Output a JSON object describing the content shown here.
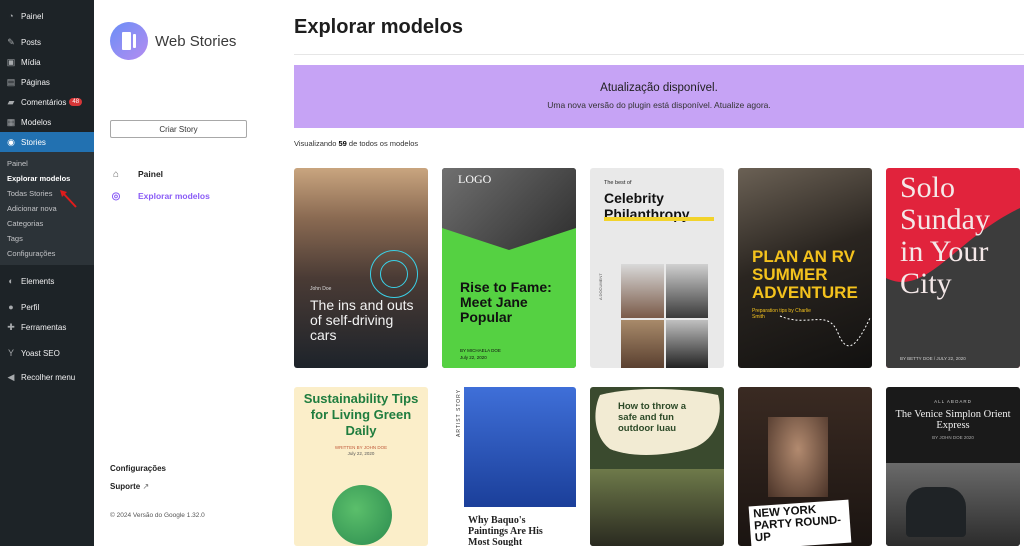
{
  "wp_menu": {
    "items": [
      {
        "label": "Painel",
        "icon": "dashboard-icon"
      },
      {
        "label": "Posts",
        "icon": "pin-icon"
      },
      {
        "label": "Mídia",
        "icon": "media-icon"
      },
      {
        "label": "Páginas",
        "icon": "pages-icon"
      },
      {
        "label": "Comentários",
        "icon": "comments-icon",
        "badge": "48"
      },
      {
        "label": "Modelos",
        "icon": "templates-icon"
      },
      {
        "label": "Stories",
        "icon": "stories-icon"
      }
    ],
    "stories_sub": [
      "Painel",
      "Explorar modelos",
      "Todas Stories",
      "Adicionar nova",
      "Categorias",
      "Tags",
      "Configurações"
    ],
    "items_after": [
      {
        "label": "Elements",
        "icon": "elements-icon"
      },
      {
        "label": "Perfil",
        "icon": "user-icon"
      },
      {
        "label": "Ferramentas",
        "icon": "wrench-icon"
      },
      {
        "label": "Yoast SEO",
        "icon": "yoast-icon"
      },
      {
        "label": "Recolher menu",
        "icon": "collapse-icon"
      }
    ]
  },
  "ws_nav": {
    "brand": "Web Stories",
    "create_button": "Criar Story",
    "links": [
      {
        "label": "Painel",
        "icon": "home-icon"
      },
      {
        "label": "Explorar modelos",
        "icon": "compass-icon"
      }
    ],
    "settings": "Configurações",
    "support": "Suporte",
    "footer": "© 2024 Versão do Google 1.32.0"
  },
  "main": {
    "title": "Explorar modelos",
    "banner_title": "Atualização disponível.",
    "banner_text": "Uma nova versão do plugin está disponível. Atualize agora.",
    "count_prefix": "Visualizando ",
    "count": "59",
    "count_suffix": " de todos os modelos"
  },
  "templates": {
    "t1": {
      "byline": "John Doe",
      "title": "The ins and outs of self-driving cars"
    },
    "t2": {
      "logo": "LOGO",
      "title": "Rise to Fame: Meet Jane Popular",
      "byline": "BY MICHAELA DOE",
      "date": "July 22, 2020"
    },
    "t3": {
      "kicker": "The best of",
      "title": "Celebrity Philanthropy",
      "side": "A DOCUMENT"
    },
    "t4": {
      "title": "PLAN AN RV SUMMER ADVENTURE",
      "sub": "Preparation tips by Charlie Smith"
    },
    "t5": {
      "title": "Solo Sunday in Your City",
      "byline": "BY BETTY DOE / JULY 22, 2020"
    },
    "t6": {
      "title": "Sustainability Tips for Living Green Daily",
      "byline": "WRITTEN BY JOHN DOE",
      "date": "July 22, 2020"
    },
    "t7": {
      "side": "ARTIST STORY",
      "title": "Why Baquo's Paintings Are His Most Sought"
    },
    "t8": {
      "title": "How to throw a safe and fun outdoor luau"
    },
    "t9": {
      "title": "NEW YORK PARTY ROUND-UP"
    },
    "t10": {
      "kicker": "ALL ABOARD",
      "title": "The Venice Simplon Orient Express",
      "byline": "BY JOHN DOE 2020"
    }
  }
}
